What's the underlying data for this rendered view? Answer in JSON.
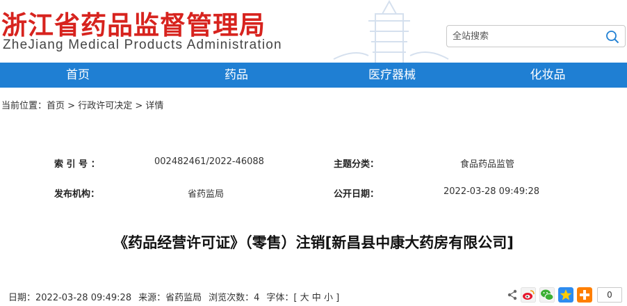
{
  "header": {
    "logo_cn": "浙江省药品监督管理局",
    "logo_en": "ZheJiang Medical Products Administration",
    "search_placeholder": "全站搜索"
  },
  "nav": {
    "items": [
      {
        "label": "首页"
      },
      {
        "label": "药品"
      },
      {
        "label": "医疗器械"
      },
      {
        "label": "化妆品"
      }
    ]
  },
  "breadcrumb": {
    "prefix": "当前位置：",
    "items": [
      "首页",
      "行政许可决定",
      "详情"
    ],
    "separator": " > "
  },
  "meta": {
    "index_label": "索 引 号 ：",
    "index_value": "002482461/2022-46088",
    "topic_label": "主题分类：",
    "topic_value": "食品药品监管",
    "publisher_label": "发布机构：",
    "publisher_value": "省药监局",
    "date_label": "公开日期：",
    "date_value": "2022-03-28 09:49:28"
  },
  "article": {
    "title": "《药品经营许可证》（零售）注销[新昌县中康大药房有限公司]"
  },
  "infobar": {
    "date_label": "日期：",
    "date_value": "2022-03-28 09:49:28",
    "source_label": "来源：",
    "source_value": "省药监局",
    "views_label": "浏览次数：",
    "views_value": "4",
    "font_label": "字体：[",
    "font_large": "大",
    "font_medium": "中",
    "font_small": "小",
    "font_close": "]"
  },
  "share": {
    "count": "0",
    "icons": [
      "share-icon",
      "weibo-icon",
      "wechat-icon",
      "qzone-icon",
      "more-icon"
    ]
  },
  "colors": {
    "brand_red": "#d7231e",
    "nav_blue": "#1f7fd3"
  }
}
